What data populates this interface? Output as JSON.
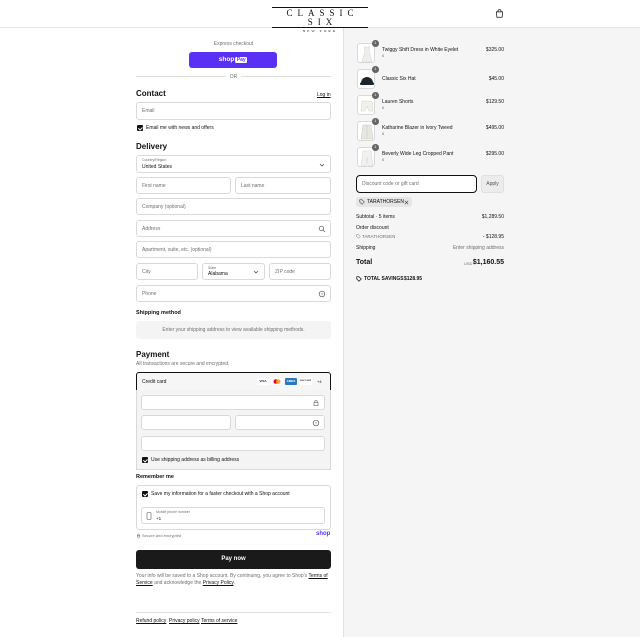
{
  "header": {
    "brand": "CLASSIC SIX",
    "brand_sub": "NEW YORK",
    "cart_icon": "shopping-bag-icon"
  },
  "express": {
    "title": "Express checkout",
    "shop_pay_label": "shop",
    "shop_pay_badge": "Pay",
    "or": "OR"
  },
  "contact": {
    "title": "Contact",
    "login": "Log in",
    "email_placeholder": "Email",
    "news_label": "Email me with news and offers"
  },
  "delivery": {
    "title": "Delivery",
    "country_label": "Country/Region",
    "country_value": "United States",
    "first_name": "First name",
    "last_name": "Last name",
    "company": "Company (optional)",
    "address": "Address",
    "apartment": "Apartment, suite, etc. (optional)",
    "city": "City",
    "state_label": "State",
    "state_value": "Alabama",
    "zip": "ZIP code",
    "phone": "Phone"
  },
  "shipping": {
    "title": "Shipping method",
    "message": "Enter your shipping address to view available shipping methods."
  },
  "payment": {
    "title": "Payment",
    "subtitle": "All transactions are secure and encrypted.",
    "method": "Credit card",
    "brands": [
      "VISA",
      "MC",
      "AMEX",
      "DISCOVER"
    ],
    "more": "+4",
    "billing_label": "Use shipping address as billing address"
  },
  "remember": {
    "title": "Remember me",
    "save_label": "Save my information for a faster checkout with a Shop account",
    "mobile_label": "Mobile phone number",
    "mobile_value": "+1",
    "secure": "Secure and encrypted",
    "shop_logo": "shop"
  },
  "pay_now": "Pay now",
  "legal": {
    "text_1": "Your info will be saved to a Shop account. By continuing, you agree to Shop's",
    "terms_link": "Terms of Service",
    "text_2": "and acknowledge the",
    "privacy_link": "Privacy Policy",
    "end": "."
  },
  "footer": {
    "links": [
      "Refund policy",
      "Privacy policy",
      "Terms of service"
    ]
  },
  "order": {
    "items": [
      {
        "qty": "1",
        "name": "Twiggy Shift Dress in White Eyelet",
        "size": "6",
        "price": "$325.00"
      },
      {
        "qty": "1",
        "name": "Classic Six Hat",
        "size": "",
        "price": "$45.00"
      },
      {
        "qty": "1",
        "name": "Lauren Shorts",
        "size": "6",
        "price": "$129.50"
      },
      {
        "qty": "1",
        "name": "Katharine Blazer in Ivory Tweed",
        "size": "6",
        "price": "$495.00"
      },
      {
        "qty": "1",
        "name": "Beverly Wide Leg Cropped Pant",
        "size": "6",
        "price": "$295.00"
      }
    ],
    "discount_placeholder": "Discount code or gift card",
    "apply": "Apply",
    "code_tag": "TARATHORSEN",
    "subtotal_label": "Subtotal · 5 items",
    "subtotal_value": "$1,289.50",
    "order_discount_label": "Order discount",
    "discount_code": "TARATHORSEN",
    "discount_value": "- $128.95",
    "shipping_label": "Shipping",
    "shipping_value": "Enter shipping address",
    "total_label": "Total",
    "currency": "USD",
    "total_value": "$1,160.55",
    "savings_label": "TOTAL SAVINGS",
    "savings_value": "$128.95"
  },
  "colors": {
    "shop_purple": "#5a31f4",
    "pay_button": "#1a1a1a",
    "summary_bg": "#f5f5f5"
  }
}
